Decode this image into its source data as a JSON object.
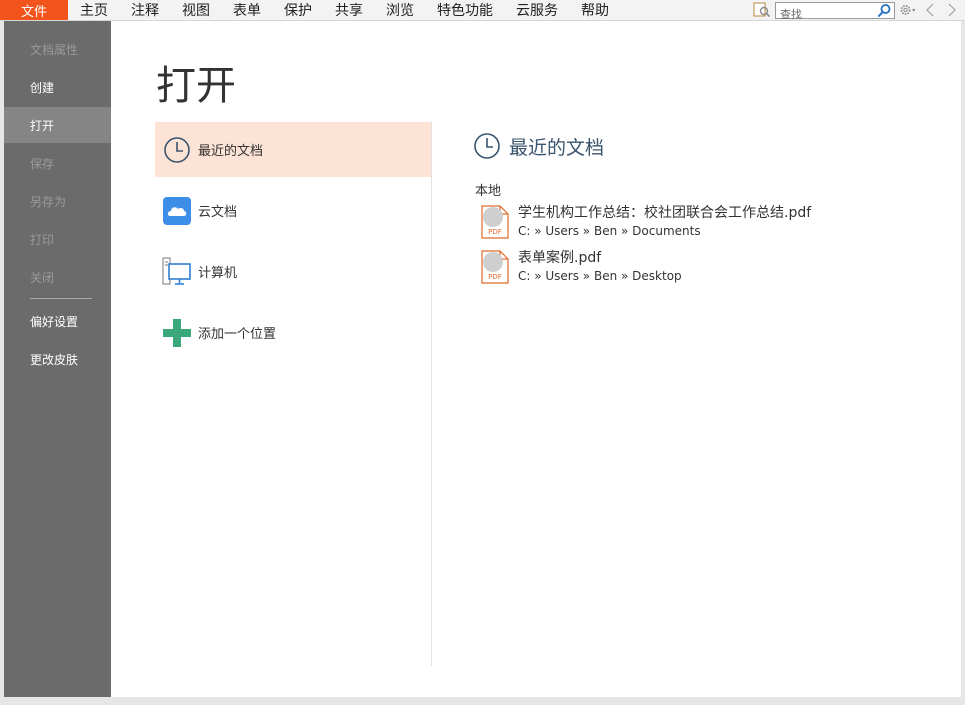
{
  "menubar": {
    "file": "文件",
    "items": [
      "主页",
      "注释",
      "视图",
      "表单",
      "保护",
      "共享",
      "浏览",
      "特色功能",
      "云服务",
      "帮助"
    ],
    "search_placeholder": "查找"
  },
  "sidebar": {
    "items": [
      {
        "label": "文档属性",
        "state": "disabled"
      },
      {
        "label": "创建",
        "state": "enabled"
      },
      {
        "label": "打开",
        "state": "active"
      },
      {
        "label": "保存",
        "state": "disabled"
      },
      {
        "label": "另存为",
        "state": "disabled"
      },
      {
        "label": "打印",
        "state": "disabled"
      },
      {
        "label": "关闭",
        "state": "disabled"
      },
      {
        "label": "偏好设置",
        "state": "enabled"
      },
      {
        "label": "更改皮肤",
        "state": "enabled"
      }
    ]
  },
  "main": {
    "title": "打开",
    "locations": [
      {
        "label": "最近的文档",
        "icon": "clock-icon",
        "selected": true
      },
      {
        "label": "云文档",
        "icon": "cloud-icon",
        "selected": false
      },
      {
        "label": "计算机",
        "icon": "computer-icon",
        "selected": false
      },
      {
        "label": "添加一个位置",
        "icon": "plus-icon",
        "selected": false
      }
    ],
    "recent": {
      "heading": "最近的文档",
      "section_label": "本地",
      "files": [
        {
          "name": "学生机构工作总结：校社团联合会工作总结.pdf",
          "path": "C: » Users » Ben » Documents",
          "icon": "pdf-file-icon",
          "icon_text": "PDF"
        },
        {
          "name": "表单案例.pdf",
          "path": "C: » Users » Ben » Desktop",
          "icon": "pdf-file-icon",
          "icon_text": "PDF"
        }
      ]
    }
  },
  "colors": {
    "accent": "#f2541b",
    "sidebar_bg": "#6b6b6b",
    "selected_bg": "#fde3d5",
    "heading_text": "#39546e"
  }
}
